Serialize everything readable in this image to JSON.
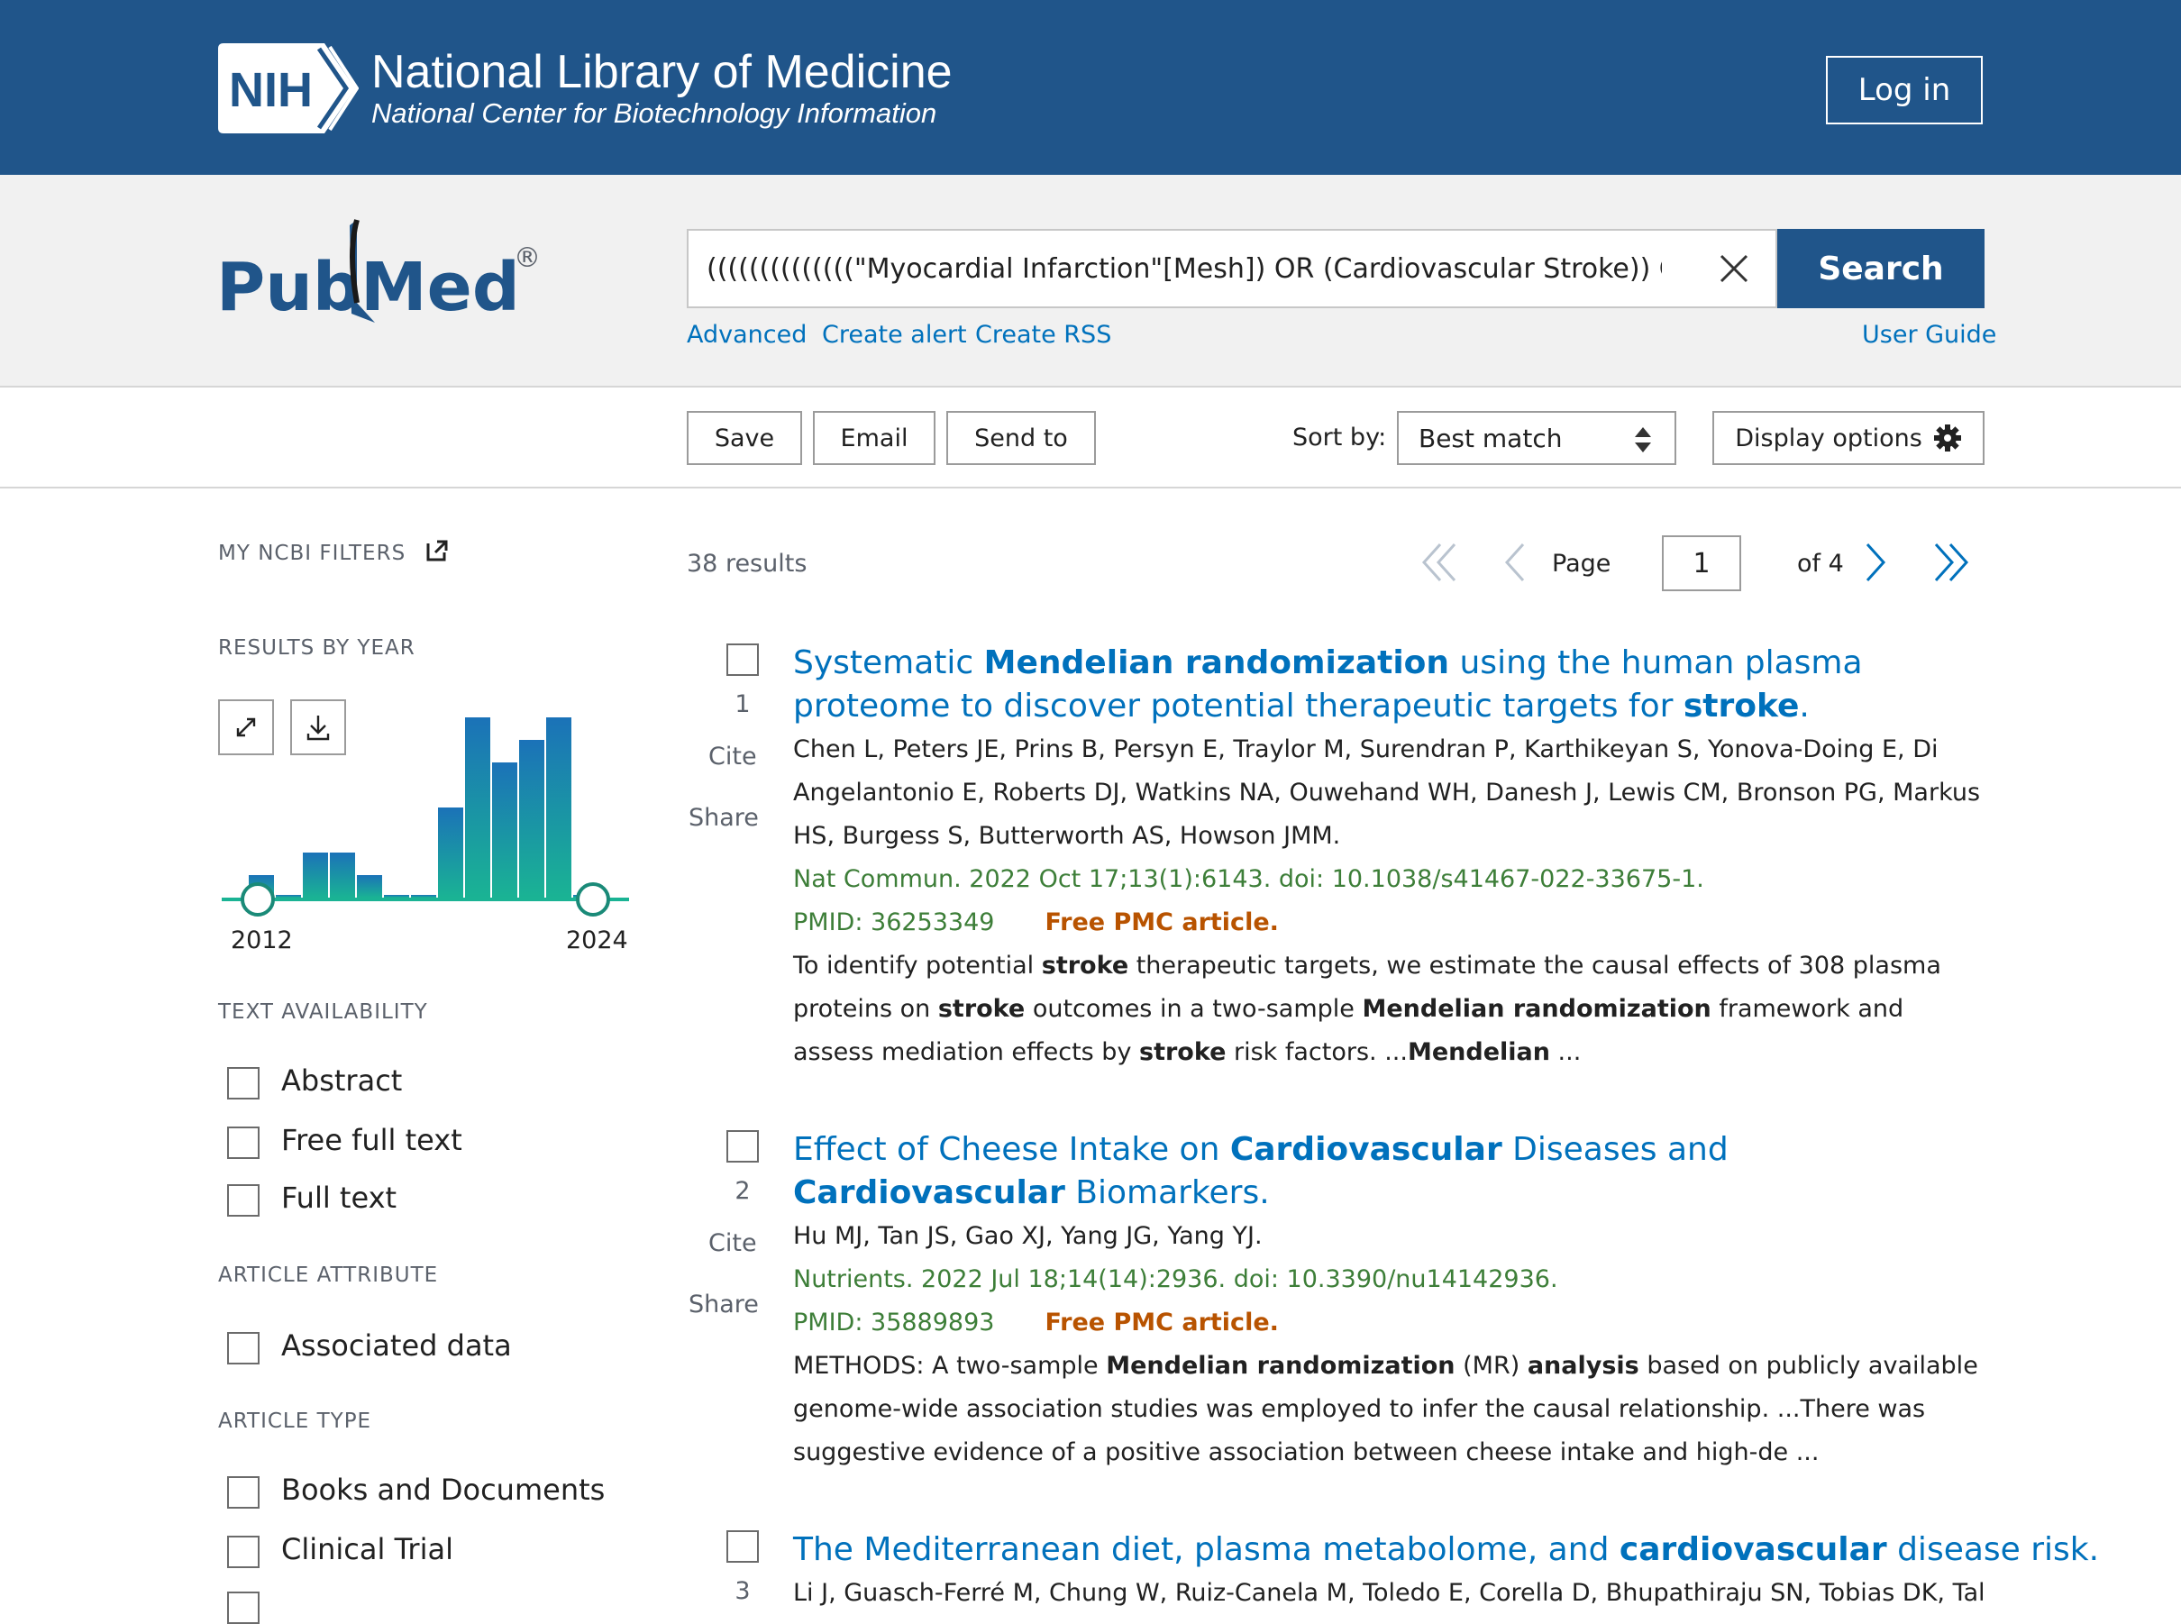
{
  "header": {
    "nih_text": "NIH",
    "title": "National Library of Medicine",
    "subtitle": "National Center for Biotechnology Information",
    "login_label": "Log in",
    "brand_color": "#20558a"
  },
  "search": {
    "logo_pub": "Pub",
    "logo_med": "Med",
    "logo_reg": "®",
    "query": "((((((((((((((\"Myocardial Infarction\"[Mesh]) OR (Cardiovascular Stroke)) OR (Heart Attack)",
    "button_label": "Search",
    "links": {
      "advanced": "Advanced",
      "create_alert": "Create alert",
      "create_rss": "Create RSS",
      "user_guide": "User Guide"
    }
  },
  "toolbar": {
    "save": "Save",
    "email": "Email",
    "send_to": "Send to",
    "sort_by_label": "Sort by:",
    "sort_value": "Best match",
    "display_options": "Display options"
  },
  "sidebar": {
    "my_ncbi_filters": "MY NCBI FILTERS",
    "results_by_year": "RESULTS BY YEAR",
    "year_start": "2012",
    "year_end": "2024",
    "text_availability": "TEXT AVAILABILITY",
    "text_options": [
      "Abstract",
      "Free full text",
      "Full text"
    ],
    "article_attribute": "ARTICLE ATTRIBUTE",
    "attribute_options": [
      "Associated data"
    ],
    "article_type": "ARTICLE TYPE",
    "type_options": [
      "Books and Documents",
      "Clinical Trial"
    ]
  },
  "chart_data": {
    "type": "bar",
    "categories": [
      "2012",
      "2013",
      "2014",
      "2015",
      "2016",
      "2017",
      "2018",
      "2019",
      "2020",
      "2021",
      "2022",
      "2023",
      "2024"
    ],
    "values": [
      1,
      0,
      2,
      2,
      1,
      0,
      0,
      4,
      8,
      6,
      7,
      8,
      0
    ],
    "ylim": [
      0,
      8
    ]
  },
  "results": {
    "count": "38 results",
    "page_label": "Page",
    "page_value": "1",
    "of_pages": "of 4",
    "items": [
      {
        "num": "1",
        "title_html": "Systematic <b>Mendelian randomization</b> using the human plasma proteome to discover potential therapeutic targets for <b>stroke</b>.",
        "authors": "Chen L, Peters JE, Prins B, Persyn E, Traylor M, Surendran P, Karthikeyan S, Yonova-Doing E, Di Angelantonio E, Roberts DJ, Watkins NA, Ouwehand WH, Danesh J, Lewis CM, Bronson PG, Markus HS, Burgess S, Butterworth AS, Howson JMM.",
        "citation": "Nat Commun. 2022 Oct 17;13(1):6143. doi: 10.1038/s41467-022-33675-1.",
        "pmid": "PMID: 36253349",
        "free": "Free PMC article.",
        "snippet_html": "To identify potential <b>stroke</b> therapeutic targets, we estimate the causal effects of 308 plasma proteins on <b>stroke</b> outcomes in a two-sample <b>Mendelian randomization</b> framework and assess mediation effects by <b>stroke</b> risk factors. ...<b>Mendelian</b> ..."
      },
      {
        "num": "2",
        "title_html": "Effect of Cheese Intake on <b>Cardiovascular</b> Diseases and <b>Cardiovascular</b> Biomarkers.",
        "authors": "Hu MJ, Tan JS, Gao XJ, Yang JG, Yang YJ.",
        "citation": "Nutrients. 2022 Jul 18;14(14):2936. doi: 10.3390/nu14142936.",
        "pmid": "PMID: 35889893",
        "free": "Free PMC article.",
        "snippet_html": "METHODS: A two-sample <b>Mendelian randomization</b> (MR) <b>analysis</b> based on publicly available genome-wide association studies was employed to infer the causal relationship. ...There was suggestive evidence of a positive association between cheese intake and high-de ..."
      },
      {
        "num": "3",
        "title_html": "The Mediterranean diet, plasma metabolome, and <b>cardiovascular</b> disease risk.",
        "authors": "Li J, Guasch-Ferré M, Chung W, Ruiz-Canela M, Toledo E, Corella D, Bhupathiraju SN, Tobias DK, Tabung"
      }
    ],
    "cite_label": "Cite",
    "share_label": "Share"
  }
}
